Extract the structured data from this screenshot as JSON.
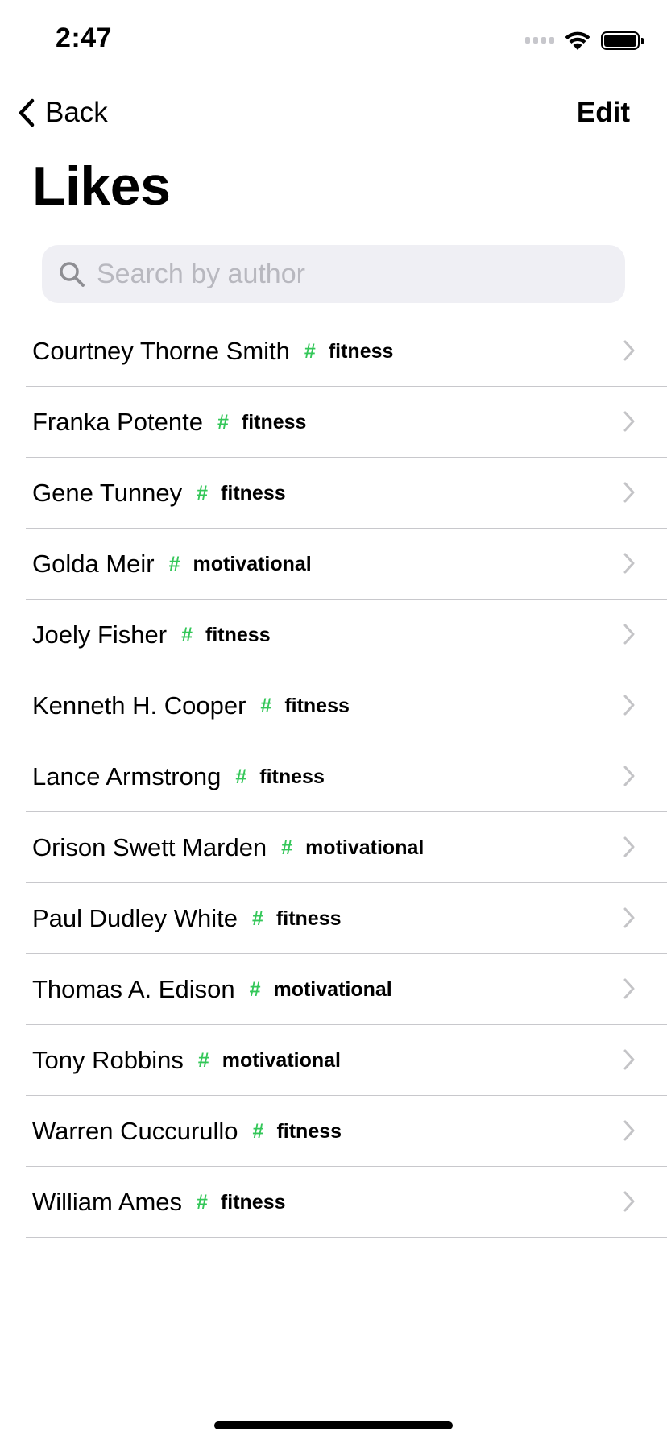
{
  "status_bar": {
    "time": "2:47",
    "icons": [
      "signal-icon",
      "wifi-icon",
      "battery-icon"
    ]
  },
  "nav": {
    "back_label": "Back",
    "back_icon": "chevron-left-icon",
    "edit_label": "Edit"
  },
  "title": "Likes",
  "search": {
    "placeholder": "Search by author",
    "value": "",
    "icon": "search-icon"
  },
  "colors": {
    "accent_green": "#34c759",
    "search_bg": "#efeff4",
    "chevron": "#c4c4c7",
    "separator": "#c8c8cc"
  },
  "items": [
    {
      "author": "Courtney Thorne Smith",
      "hash": "#",
      "tag": "fitness"
    },
    {
      "author": "Franka Potente",
      "hash": "#",
      "tag": "fitness"
    },
    {
      "author": "Gene Tunney",
      "hash": "#",
      "tag": "fitness"
    },
    {
      "author": "Golda Meir",
      "hash": "#",
      "tag": "motivational"
    },
    {
      "author": "Joely Fisher",
      "hash": "#",
      "tag": "fitness"
    },
    {
      "author": "Kenneth H. Cooper",
      "hash": "#",
      "tag": "fitness"
    },
    {
      "author": "Lance Armstrong",
      "hash": "#",
      "tag": "fitness"
    },
    {
      "author": "Orison Swett Marden",
      "hash": "#",
      "tag": "motivational"
    },
    {
      "author": "Paul Dudley White",
      "hash": "#",
      "tag": "fitness"
    },
    {
      "author": "Thomas A. Edison",
      "hash": "#",
      "tag": "motivational"
    },
    {
      "author": "Tony Robbins",
      "hash": "#",
      "tag": "motivational"
    },
    {
      "author": "Warren Cuccurullo",
      "hash": "#",
      "tag": "fitness"
    },
    {
      "author": "William Ames",
      "hash": "#",
      "tag": "fitness"
    }
  ]
}
